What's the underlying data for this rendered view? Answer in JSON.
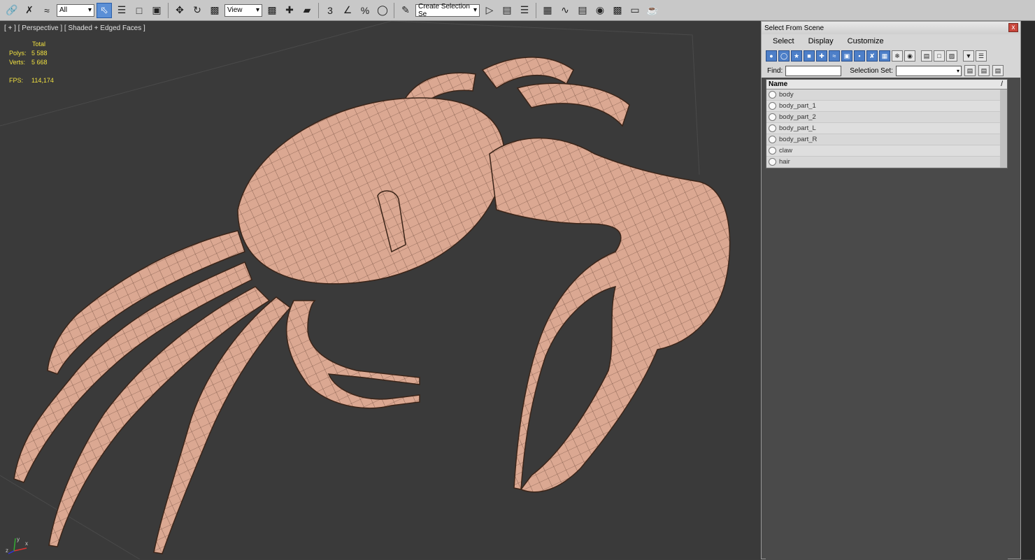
{
  "toolbar": {
    "filter_value": "All",
    "coord_value": "View",
    "selection_set_placeholder": "Create Selection Se"
  },
  "viewport": {
    "label": "[ + ] [ Perspective ] [ Shaded + Edged Faces ]",
    "stats": {
      "total_label": "Total",
      "polys_label": "Polys:",
      "polys_value": "5 588",
      "verts_label": "Verts:",
      "verts_value": "5 668",
      "fps_label": "FPS:",
      "fps_value": "114,174"
    },
    "axis": {
      "x": "x",
      "y": "y",
      "z": "z"
    }
  },
  "dialog": {
    "title": "Select From Scene",
    "close_glyph": "x",
    "menu": [
      "Select",
      "Display",
      "Customize"
    ],
    "find_label": "Find:",
    "selection_set_label": "Selection Set:",
    "list_header": "Name",
    "sort_glyph": "/",
    "items": [
      "body",
      "body_part_1",
      "body_part_2",
      "body_part_L",
      "body_part_R",
      "claw",
      "hair"
    ]
  }
}
